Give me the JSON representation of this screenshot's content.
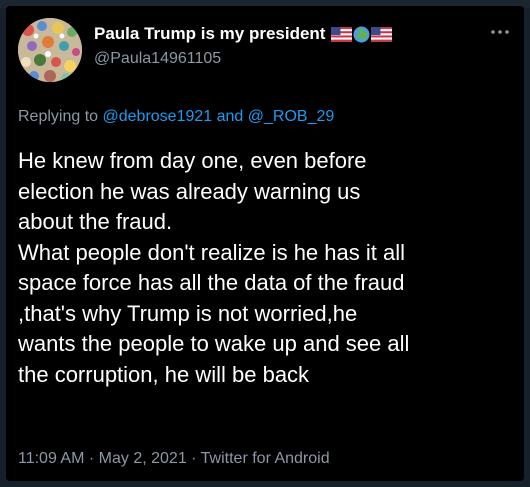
{
  "tweet": {
    "display_name": "Paula Trump is my president",
    "handle": "@Paula14961105",
    "flag_icons": [
      "us-flag-icon",
      "globe-icon",
      "us-flag-icon"
    ],
    "reply": {
      "prefix": "Replying to",
      "mention_1": "@debrose1921",
      "conjunction": "and",
      "mention_2": "@_ROB_29"
    },
    "body_lines": [
      "He knew from day one, even before",
      "election he was already warning us",
      "about the fraud.",
      "What people don't realize is he has it all",
      "space force has all the data of the fraud",
      ",that's why Trump is not worried,he",
      "wants the people to wake up and see all",
      "the corruption, he will be back"
    ],
    "time": "11:09 AM",
    "separator": "·",
    "date": "May 2, 2021",
    "source": "Twitter for Android"
  },
  "colors": {
    "background": "#000000",
    "text": "#ffffff",
    "secondary_text": "#8b98a5",
    "link": "#1d9bf0"
  },
  "icons": {
    "more": "more-horizontal-icon",
    "avatar": "avatar"
  }
}
